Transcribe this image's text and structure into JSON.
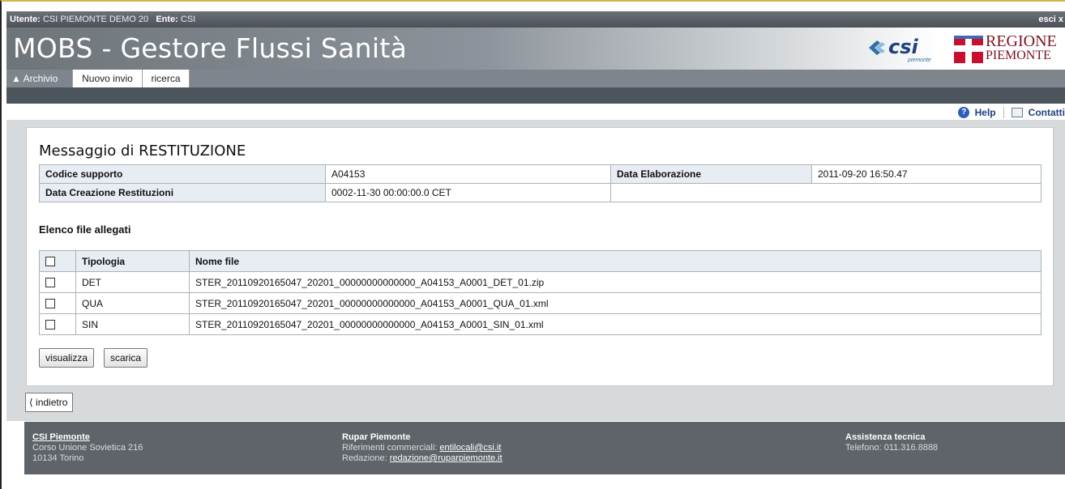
{
  "userbar": {
    "utente_label": "Utente:",
    "utente_value": "CSI PIEMONTE DEMO 20",
    "ente_label": "Ente:",
    "ente_value": "CSI",
    "logout": "esci x"
  },
  "header": {
    "title": "MOBS - Gestore Flussi Sanità",
    "csi_logo": "csi",
    "csi_logo_sub": "piemonte",
    "regione_line1": "REGIONE",
    "regione_line2": "PIEMONTE"
  },
  "tabs": [
    {
      "label": "Archivio",
      "icon": "home-icon",
      "active": true
    },
    {
      "label": "Nuovo invio",
      "active": false
    },
    {
      "label": "ricerca",
      "active": false
    }
  ],
  "links": {
    "help": "Help",
    "contatti": "Contatti"
  },
  "main": {
    "title": "Messaggio di RESTITUZIONE",
    "info": {
      "codice_supporto_label": "Codice supporto",
      "codice_supporto_value": "A04153",
      "data_elaborazione_label": "Data Elaborazione",
      "data_elaborazione_value": "2011-09-20 16:50.47",
      "data_creazione_label": "Data Creazione Restituzioni",
      "data_creazione_value": "0002-11-30 00:00:00.0 CET"
    },
    "files_title": "Elenco file allegati",
    "columns": [
      "Tipologia",
      "Nome file"
    ],
    "files": [
      {
        "tipologia": "DET",
        "nome": "STER_20110920165047_20201_00000000000000_A04153_A0001_DET_01.zip"
      },
      {
        "tipologia": "QUA",
        "nome": "STER_20110920165047_20201_00000000000000_A04153_A0001_QUA_01.xml"
      },
      {
        "tipologia": "SIN",
        "nome": "STER_20110920165047_20201_00000000000000_A04153_A0001_SIN_01.xml"
      }
    ],
    "buttons": {
      "visualizza": "visualizza",
      "scarica": "scarica"
    },
    "back": "indietro"
  },
  "footer": {
    "csi_title": "CSI Piemonte",
    "csi_line1": "Corso Unione Sovietica 216",
    "csi_line2": "10134 Torino",
    "rupar_title": "Rupar Piemonte",
    "rupar_line1_label": "Riferimenti commerciali:",
    "rupar_line1_link": "entilocali@csi.it",
    "rupar_line2_label": "Redazione:",
    "rupar_line2_link": "redazione@ruparpiemonte.it",
    "assist_title": "Assistenza tecnica",
    "assist_line": "Telefono: 011.316.8888"
  },
  "colors": {
    "header_gray": "#7e858c",
    "dark_bar": "#4d555c",
    "label_bg": "#e7edf3",
    "footer_bg": "#5e6469",
    "link_blue": "#20407f"
  }
}
